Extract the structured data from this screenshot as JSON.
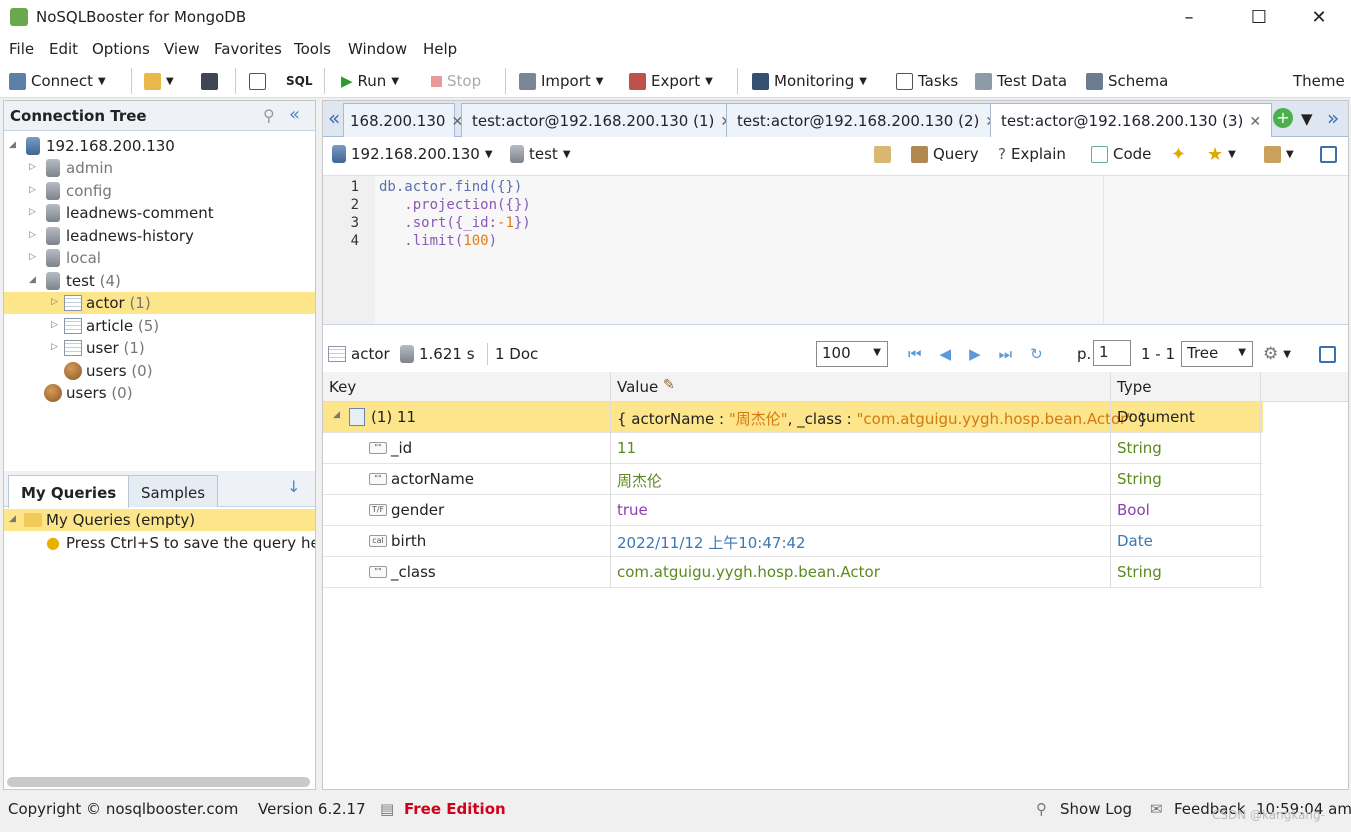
{
  "window": {
    "title": "NoSQLBooster for MongoDB"
  },
  "menu": [
    "File",
    "Edit",
    "Options",
    "View",
    "Favorites",
    "Tools",
    "Window",
    "Help"
  ],
  "toolbar": {
    "connect": "Connect",
    "run": "Run",
    "stop": "Stop",
    "import": "Import",
    "export": "Export",
    "monitoring": "Monitoring",
    "tasks": "Tasks",
    "test_data": "Test Data",
    "schema": "Schema",
    "theme": "Theme",
    "sql": "SQL"
  },
  "connection_tree": {
    "title": "Connection Tree",
    "server": "192.168.200.130",
    "databases": [
      "admin",
      "config",
      "leadnews-comment",
      "leadnews-history",
      "local"
    ],
    "test_db": {
      "name": "test",
      "count": "(4)"
    },
    "collections": [
      {
        "name": "actor",
        "count": "(1)"
      },
      {
        "name": "article",
        "count": "(5)"
      },
      {
        "name": "user",
        "count": "(1)"
      },
      {
        "name": "users",
        "count": "(0)"
      }
    ],
    "server_users": {
      "name": "users",
      "count": "(0)"
    }
  },
  "queries_panel": {
    "tabs": [
      "My Queries",
      "Samples"
    ],
    "root": "My Queries (empty)",
    "hint": "Press Ctrl+S to save the query here"
  },
  "tabs": [
    {
      "label": "168.200.130"
    },
    {
      "label": "test:actor@192.168.200.130 (1)"
    },
    {
      "label": "test:actor@192.168.200.130 (2)"
    },
    {
      "label": "test:actor@192.168.200.130 (3)"
    }
  ],
  "subbar": {
    "server": "192.168.200.130",
    "db": "test",
    "query": "Query",
    "explain": "Explain",
    "code": "Code"
  },
  "editor": {
    "line_numbers": [
      "1",
      "2",
      "3",
      "4"
    ],
    "line1_a": "db.actor.find({",
    "line1_b": "})",
    "line2": "   .projection({})",
    "line3_a": "   .sort({_id:",
    "line3_b": "-1",
    "line3_c": "})",
    "line4_a": "   .limit(",
    "line4_b": "100",
    "line4_c": ")"
  },
  "results": {
    "collection": "actor",
    "time": "1.621 s",
    "docs": "1 Doc",
    "page_size": "100",
    "page_label": "p.",
    "page": "1",
    "range": "1 - 1",
    "view_mode": "Tree",
    "headers": {
      "key": "Key",
      "value": "Value",
      "type": "Type"
    },
    "doc": {
      "key": "(1) 11",
      "value_parts": [
        "{ actorName : ",
        "\"周杰伦\"",
        ", _class : ",
        "\"com.atguigu.yygh.hosp.bean.Actor\"",
        " }"
      ],
      "type": "Document"
    },
    "fields": [
      {
        "icon": "\"\"",
        "key": "_id",
        "value": "11",
        "type": "String",
        "color": "green"
      },
      {
        "icon": "\"\"",
        "key": "actorName",
        "value": "周杰伦",
        "type": "String",
        "color": "green"
      },
      {
        "icon": "T/F",
        "key": "gender",
        "value": "true",
        "type": "Bool",
        "color": "purple"
      },
      {
        "icon": "cal",
        "key": "birth",
        "value": "2022/11/12 上午10:47:42",
        "type": "Date",
        "color": "blue"
      },
      {
        "icon": "\"\"",
        "key": "_class",
        "value": "com.atguigu.yygh.hosp.bean.Actor",
        "type": "String",
        "color": "green"
      }
    ]
  },
  "status": {
    "copyright": "Copyright ©  nosqlbooster.com",
    "version": "Version 6.2.17",
    "edition": "Free Edition",
    "show_log": "Show Log",
    "feedback": "Feedback",
    "time": "10:59:04 am",
    "watermark": "CSDN @kangkang-"
  },
  "colors": {
    "selection": "#fde58b",
    "string": "#5b8a1e",
    "bool": "#8a3fb0",
    "date": "#3c76b5",
    "edition": "#d0021b"
  }
}
